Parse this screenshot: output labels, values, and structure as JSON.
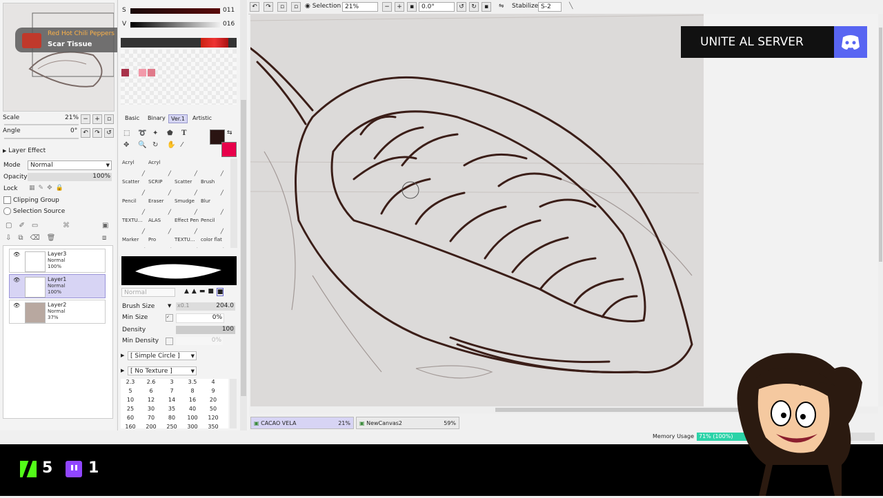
{
  "now_playing": {
    "artist": "Red Hot Chili Peppers",
    "track": "Scar Tissue"
  },
  "color_sliders": {
    "s_label": "S",
    "s_value": "011",
    "v_label": "V",
    "v_value": "016"
  },
  "navigator": {
    "scale_label": "Scale",
    "scale_value": "21%",
    "angle_label": "Angle",
    "angle_value": "0°"
  },
  "layer_panel": {
    "effect_label": "Layer Effect",
    "mode_label": "Mode",
    "mode_value": "Normal",
    "opacity_label": "Opacity",
    "opacity_value": "100%",
    "lock_label": "Lock",
    "clipping_label": "Clipping Group",
    "selection_source_label": "Selection Source",
    "layers": [
      {
        "name": "Layer3",
        "mode": "Normal",
        "opacity": "100%"
      },
      {
        "name": "Layer1",
        "mode": "Normal",
        "opacity": "100%"
      },
      {
        "name": "Layer2",
        "mode": "Normal",
        "opacity": "37%"
      }
    ]
  },
  "tool_tabs": [
    "Basic",
    "Binary",
    "Ver.1",
    "Artistic"
  ],
  "tools": [
    [
      "Acryl",
      "Acryl",
      "",
      ""
    ],
    [
      "Scatter",
      "SCRIP",
      "Scatter",
      "Brush"
    ],
    [
      "Pencil",
      "Eraser",
      "Smudge",
      "Blur"
    ],
    [
      "TEXTU...",
      "ALAS",
      "Effect Pen",
      "Pencil"
    ],
    [
      "Marker",
      "Pro",
      "TEXTU...",
      "color flat"
    ]
  ],
  "brush": {
    "blend_mode": "Normal",
    "size_label": "Brush Size",
    "size_multiplier": "x0.1",
    "size_value": "204.0",
    "min_size_label": "Min Size",
    "min_size_value": "0%",
    "density_label": "Density",
    "density_value": "100",
    "min_density_label": "Min Density",
    "min_density_value": "0%",
    "shape": "[ Simple Circle ]",
    "texture": "[ No Texture ]"
  },
  "brush_sizes": [
    [
      "2.3",
      "2.6",
      "3",
      "3.5",
      "4"
    ],
    [
      "5",
      "6",
      "7",
      "8",
      "9"
    ],
    [
      "10",
      "12",
      "14",
      "16",
      "20"
    ],
    [
      "25",
      "30",
      "35",
      "40",
      "50"
    ],
    [
      "60",
      "70",
      "80",
      "100",
      "120"
    ],
    [
      "160",
      "200",
      "250",
      "300",
      "350"
    ]
  ],
  "toolbar": {
    "selection_label": "Selection",
    "zoom_value": "21%",
    "rotation_value": "0.0°",
    "stabilizer_label": "Stabilizer",
    "stabilizer_value": "S-2"
  },
  "documents": [
    {
      "name": "CACAO VELA",
      "zoom": "21%"
    },
    {
      "name": "NewCanvas2",
      "zoom": "59%"
    }
  ],
  "memory": {
    "label": "Memory Usage",
    "value": "71% (100%)"
  },
  "overlay": {
    "discord_text": "UNITE AL SERVER",
    "kick_count": "5",
    "twitch_count": "1"
  },
  "colors": {
    "accent_red": "#e8004b",
    "discord": "#5865f2",
    "kick": "#53fc18",
    "twitch": "#9146ff",
    "memory_bar": "#2bd3a8"
  }
}
